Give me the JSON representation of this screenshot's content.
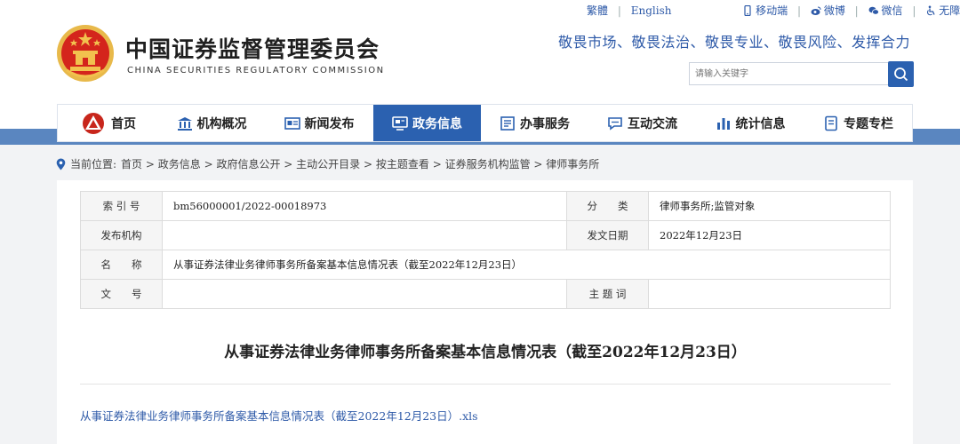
{
  "header": {
    "site_name": "中国证券监督管理委员会",
    "site_name_en": "CHINA SECURITIES REGULATORY COMMISSION",
    "slogan": "敬畏市场、敬畏法治、敬畏专业、敬畏风险、发挥合力",
    "top_links": {
      "traditional": "繁體",
      "english": "English",
      "mobile": "移动端",
      "weibo": "微博",
      "wechat": "微信",
      "accessibility": "无障碍"
    },
    "search": {
      "placeholder": "请输入关键字"
    }
  },
  "nav": {
    "items": [
      {
        "label": "首页",
        "icon": "home-logo-icon"
      },
      {
        "label": "机构概况",
        "icon": "building-icon"
      },
      {
        "label": "新闻发布",
        "icon": "newspaper-icon"
      },
      {
        "label": "政务信息",
        "icon": "monitor-icon",
        "active": true
      },
      {
        "label": "办事服务",
        "icon": "list-icon"
      },
      {
        "label": "互动交流",
        "icon": "chat-icon"
      },
      {
        "label": "统计信息",
        "icon": "bar-chart-icon"
      },
      {
        "label": "专题专栏",
        "icon": "document-icon"
      }
    ]
  },
  "breadcrumb": {
    "prefix": "当前位置:",
    "path": [
      "首页",
      "政务信息",
      "政府信息公开",
      "主动公开目录",
      "按主题查看",
      "证券服务机构监管",
      "律师事务所"
    ],
    "separator": " > "
  },
  "meta": {
    "index_label": "索 引 号",
    "index_value": "bm56000001/2022-00018973",
    "category_label": "分　　类",
    "category_value": "律师事务所;监管对象",
    "publisher_label": "发布机构",
    "publisher_value": "",
    "date_label": "发文日期",
    "date_value": "2022年12月23日",
    "name_label": "名　　称",
    "name_value": "从事证券法律业务律师事务所备案基本信息情况表（截至2022年12月23日）",
    "doc_no_label": "文　　号",
    "doc_no_value": "",
    "subject_label": "主 题 词",
    "subject_value": ""
  },
  "document": {
    "title": "从事证券法律业务律师事务所备案基本信息情况表（截至2022年12月23日）",
    "attachment": "从事证券法律业务律师事务所备案基本信息情况表（截至2022年12月23日）.xls"
  },
  "colors": {
    "primary": "#2b61b0",
    "band": "#5a86c0",
    "emblem_red": "#d4251c",
    "emblem_gold": "#f2c14e"
  }
}
